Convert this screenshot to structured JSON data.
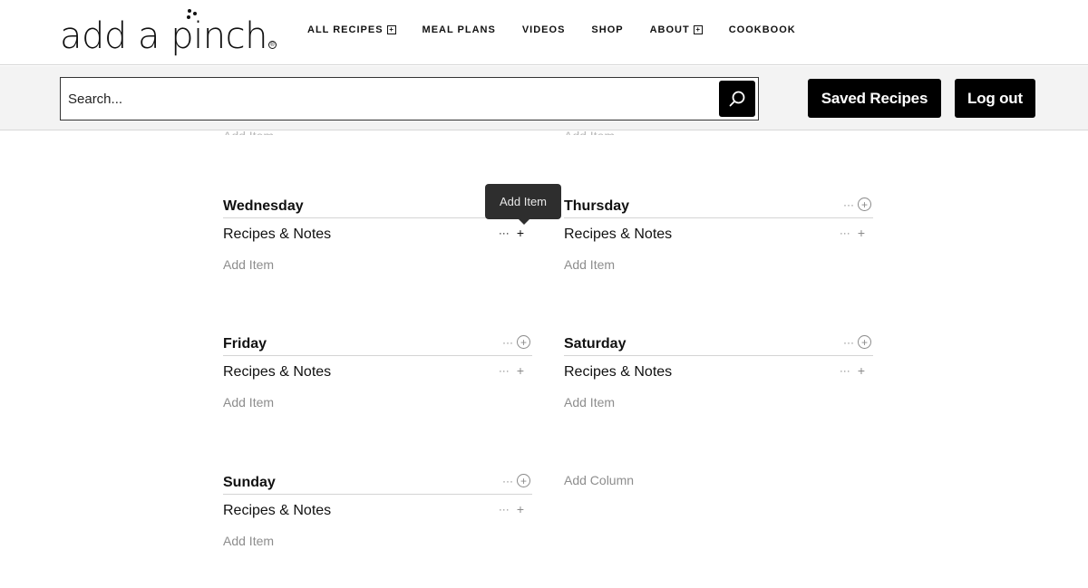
{
  "site": {
    "logo_text": "add a pinch",
    "logo_mark": "®"
  },
  "nav": {
    "items": [
      {
        "label": "ALL RECIPES",
        "has_submenu": true
      },
      {
        "label": "MEAL PLANS",
        "has_submenu": false
      },
      {
        "label": "VIDEOS",
        "has_submenu": false
      },
      {
        "label": "SHOP",
        "has_submenu": false
      },
      {
        "label": "ABOUT",
        "has_submenu": true
      },
      {
        "label": "COOKBOOK",
        "has_submenu": false
      }
    ],
    "submenu_icon": "+"
  },
  "search": {
    "placeholder": "Search...",
    "value": "",
    "button_icon": "search-icon"
  },
  "actions": {
    "saved_recipes": "Saved Recipes",
    "log_out": "Log out"
  },
  "board": {
    "hidden_row_text": [
      "Add Item",
      "Add Item"
    ],
    "columns": [
      {
        "title": "Wednesday",
        "group": "Recipes & Notes",
        "add_item": "Add Item"
      },
      {
        "title": "Thursday",
        "group": "Recipes & Notes",
        "add_item": "Add Item"
      },
      {
        "title": "Friday",
        "group": "Recipes & Notes",
        "add_item": "Add Item"
      },
      {
        "title": "Saturday",
        "group": "Recipes & Notes",
        "add_item": "Add Item"
      },
      {
        "title": "Sunday",
        "group": "Recipes & Notes",
        "add_item": "Add Item"
      }
    ],
    "add_column": "Add Column",
    "more_icon": "···",
    "add_icon": "+"
  },
  "tooltip": {
    "text": "Add Item"
  }
}
